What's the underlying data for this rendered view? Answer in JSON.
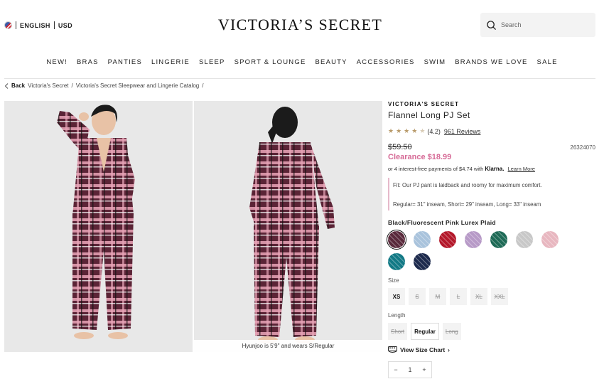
{
  "header": {
    "language": "ENGLISH",
    "currency": "USD",
    "logo": "VICTORIA’S SECRET",
    "search_placeholder": "Search"
  },
  "nav": [
    "NEW!",
    "BRAS",
    "PANTIES",
    "LINGERIE",
    "SLEEP",
    "SPORT & LOUNGE",
    "BEAUTY",
    "ACCESSORIES",
    "SWIM",
    "BRANDS WE LOVE",
    "SALE"
  ],
  "breadcrumb": {
    "back": "Back",
    "items": [
      "Victoria's Secret",
      "/",
      "Victoria's Secret Sleepwear and Lingerie Catalog",
      "/"
    ]
  },
  "gallery": {
    "caption": "Hyunjoo is 5'9\" and wears S/Regular"
  },
  "product": {
    "brand": "VICTORIA’S SECRET",
    "name": "Flannel Long PJ Set",
    "rating_value": 4.2,
    "rating_text": "(4.2)",
    "reviews": "961 Reviews",
    "original_price": "$59.50",
    "sku": "26324070",
    "clearance_price": "Clearance $18.99",
    "klarna_prefix": "or 4 interest-free payments of $4.74 with",
    "klarna_brand": "Klarna.",
    "klarna_link": "Learn More",
    "fit_line1": "Fit: Our PJ pant is laidback and roomy for maximum comfort.",
    "fit_line2": "Regular= 31\" inseam, Short= 29\" inseam, Long= 33\" inseam",
    "color_name": "Black/Fluorescent Pink Lurex Plaid",
    "size_label": "Size",
    "sizes": [
      {
        "label": "XS",
        "available": true
      },
      {
        "label": "S",
        "available": false
      },
      {
        "label": "M",
        "available": false
      },
      {
        "label": "L",
        "available": false
      },
      {
        "label": "XL",
        "available": false
      },
      {
        "label": "XXL",
        "available": false
      }
    ],
    "length_label": "Length",
    "lengths": [
      {
        "label": "Short",
        "available": false
      },
      {
        "label": "Regular",
        "available": true
      },
      {
        "label": "Long",
        "available": false
      }
    ],
    "size_chart": "View Size Chart",
    "quantity": "1"
  },
  "swatch_colors": [
    "#5a2a3c",
    "#a9c3dc",
    "#b4192b",
    "#b79ac7",
    "#1f6b57",
    "#c8c8c8",
    "#e8b7c0",
    "#137a86",
    "#1d2a4d"
  ],
  "accent_color": "#d66a96"
}
